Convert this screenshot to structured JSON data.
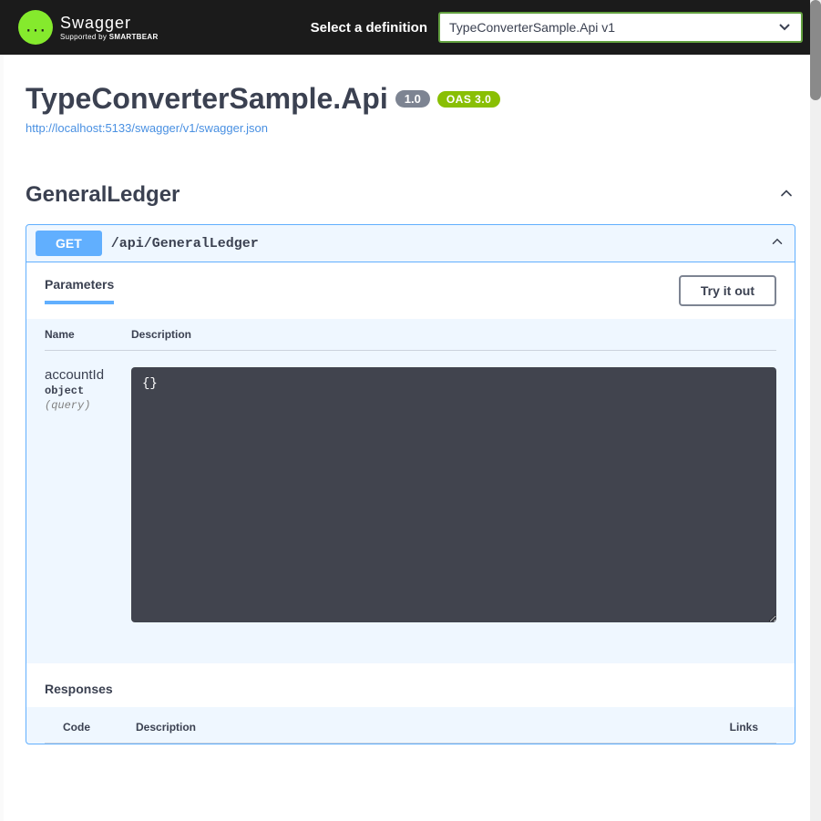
{
  "topbar": {
    "logo_title": "Swagger",
    "logo_supported": "Supported by",
    "logo_brand": "SMARTBEAR",
    "select_label": "Select a definition",
    "select_value": "TypeConverterSample.Api v1"
  },
  "api": {
    "title": "TypeConverterSample.Api",
    "version_badge": "1.0",
    "oas_badge": "OAS 3.0",
    "json_url": "http://localhost:5133/swagger/v1/swagger.json"
  },
  "tag": {
    "name": "GeneralLedger"
  },
  "operation": {
    "method": "GET",
    "path": "/api/GeneralLedger",
    "parameters_label": "Parameters",
    "tryout_label": "Try it out",
    "table": {
      "name_header": "Name",
      "desc_header": "Description"
    },
    "params": [
      {
        "name": "accountId",
        "type": "object",
        "in": "(query)",
        "value": "{}"
      }
    ],
    "responses_label": "Responses",
    "resp_headers": {
      "code": "Code",
      "desc": "Description",
      "links": "Links"
    }
  }
}
